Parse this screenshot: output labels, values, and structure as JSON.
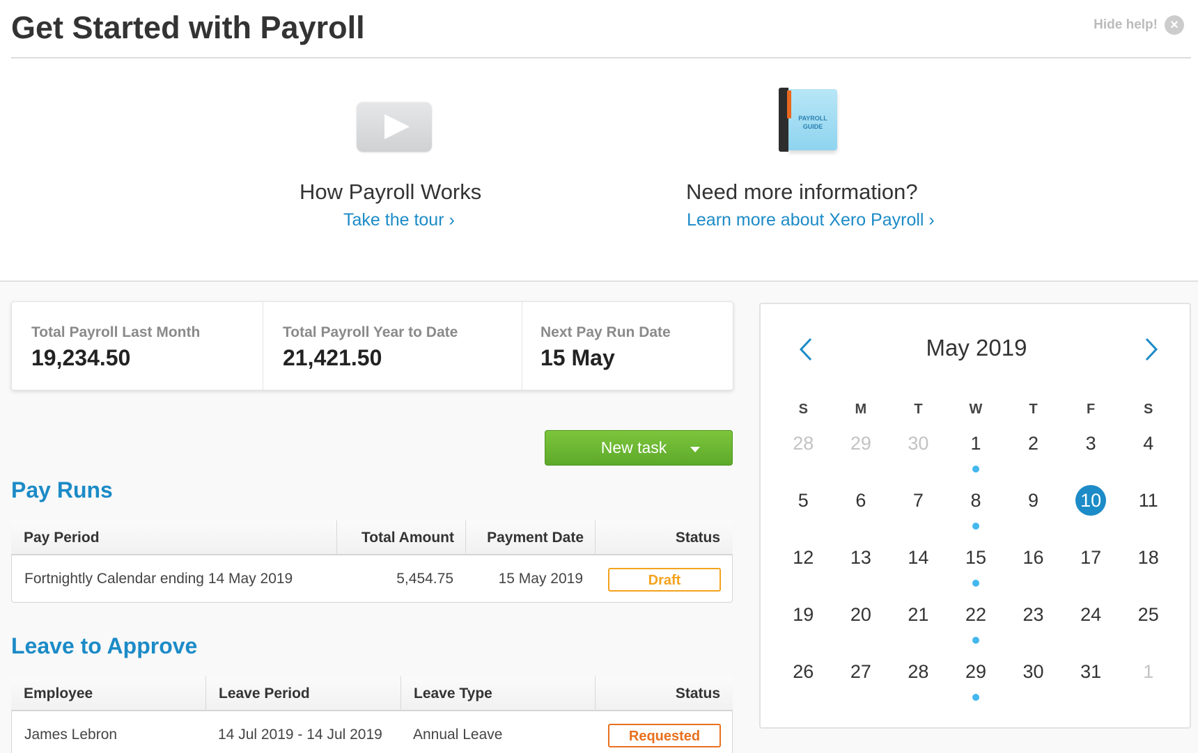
{
  "header": {
    "title": "Get Started with Payroll",
    "hide_help_label": "Hide help!"
  },
  "help": {
    "tour": {
      "heading": "How Payroll Works",
      "link": "Take the tour ›",
      "icon": "video-play-icon"
    },
    "info": {
      "heading": "Need more information?",
      "link": "Learn more about Xero Payroll ›",
      "icon": "payroll-guide-book-icon",
      "book_line1": "PAYROLL",
      "book_line2": "GUIDE"
    }
  },
  "summary": [
    {
      "label": "Total Payroll Last Month",
      "value": "19,234.50"
    },
    {
      "label": "Total Payroll Year to Date",
      "value": "21,421.50"
    },
    {
      "label": "Next Pay Run Date",
      "value": "15 May"
    }
  ],
  "new_task": {
    "label": "New task"
  },
  "pay_runs": {
    "title": "Pay Runs",
    "columns": [
      "Pay Period",
      "Total Amount",
      "Payment Date",
      "Status"
    ],
    "rows": [
      {
        "pay_period": "Fortnightly Calendar ending 14 May 2019",
        "total_amount": "5,454.75",
        "payment_date": "15 May 2019",
        "status": "Draft"
      }
    ]
  },
  "leave": {
    "title": "Leave to Approve",
    "columns": [
      "Employee",
      "Leave Period",
      "Leave Type",
      "Status"
    ],
    "rows": [
      {
        "employee": "James Lebron",
        "leave_period": "14 Jul 2019 - 14 Jul 2019",
        "leave_type": "Annual Leave",
        "status": "Requested"
      }
    ]
  },
  "calendar": {
    "month_label": "May 2019",
    "weekdays": [
      "S",
      "M",
      "T",
      "W",
      "T",
      "F",
      "S"
    ],
    "weeks": [
      [
        "28",
        "29",
        "30",
        "1",
        "2",
        "3",
        "4"
      ],
      [
        "5",
        "6",
        "7",
        "8",
        "9",
        "10",
        "11"
      ],
      [
        "12",
        "13",
        "14",
        "15",
        "16",
        "17",
        "18"
      ],
      [
        "19",
        "20",
        "21",
        "22",
        "23",
        "24",
        "25"
      ],
      [
        "26",
        "27",
        "28",
        "29",
        "30",
        "31",
        "1"
      ]
    ],
    "muted_days": [
      "0-0",
      "0-1",
      "0-2",
      "4-6"
    ],
    "selected_day": "10",
    "event_days": [
      "1",
      "8",
      "15",
      "22",
      "29"
    ],
    "colors": {
      "accent": "#1c8bc7",
      "event_dot": "#43b7ee",
      "button_green": "#6bb933",
      "draft": "#f4a21d",
      "requested": "#e8701d"
    }
  }
}
